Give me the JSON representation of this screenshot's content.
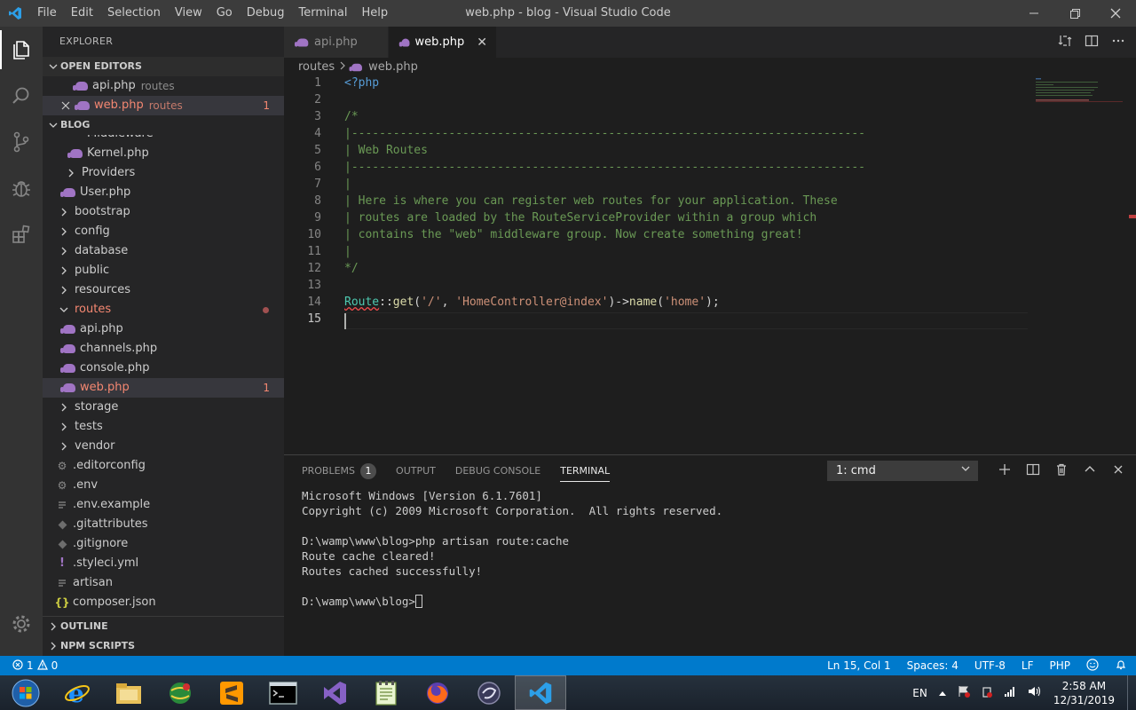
{
  "titlebar": {
    "menu": [
      "File",
      "Edit",
      "Selection",
      "View",
      "Go",
      "Debug",
      "Terminal",
      "Help"
    ],
    "title": "web.php - blog - Visual Studio Code"
  },
  "sidebar": {
    "header": "EXPLORER",
    "open_editors_label": "OPEN EDITORS",
    "open_editors": [
      {
        "name": "api.php",
        "desc": "routes",
        "badge": ""
      },
      {
        "name": "web.php",
        "desc": "routes",
        "badge": "1"
      }
    ],
    "project_label": "BLOG",
    "tree": {
      "partial_top": "Middleware",
      "kernel": "Kernel.php",
      "providers": "Providers",
      "user": "User.php",
      "bootstrap": "bootstrap",
      "config": "config",
      "database": "database",
      "public": "public",
      "resources": "resources",
      "routes": "routes",
      "api": "api.php",
      "channels": "channels.php",
      "console": "console.php",
      "web": "web.php",
      "web_badge": "1",
      "storage": "storage",
      "tests": "tests",
      "vendor": "vendor",
      "editorconfig": ".editorconfig",
      "env": ".env",
      "env_example": ".env.example",
      "gitattributes": ".gitattributes",
      "gitignore": ".gitignore",
      "styleci": ".styleci.yml",
      "artisan": "artisan",
      "composer": "composer.json"
    },
    "outline_label": "OUTLINE",
    "npm_label": "NPM SCRIPTS"
  },
  "tabs": [
    {
      "label": "api.php"
    },
    {
      "label": "web.php"
    }
  ],
  "breadcrumb": {
    "folder": "routes",
    "file": "web.php"
  },
  "code": {
    "line_numbers": [
      "1",
      "2",
      "3",
      "4",
      "5",
      "6",
      "7",
      "8",
      "9",
      "10",
      "11",
      "12",
      "13",
      "14",
      "15"
    ],
    "l1": "<?php",
    "l3": "/*",
    "l4": "|--------------------------------------------------------------------------",
    "l5": "| Web Routes",
    "l6": "|--------------------------------------------------------------------------",
    "l7": "|",
    "l8": "| Here is where you can register web routes for your application. These",
    "l9": "| routes are loaded by the RouteServiceProvider within a group which",
    "l10": "| contains the \"web\" middleware group. Now create something great!",
    "l11": "|",
    "l12": "*/",
    "l14_class": "Route",
    "l14_op1": "::",
    "l14_fn1": "get",
    "l14_p1": "(",
    "l14_s1": "'/'",
    "l14_comma": ", ",
    "l14_s2": "'HomeController@index'",
    "l14_p2": ")->",
    "l14_fn2": "name",
    "l14_p3": "(",
    "l14_s3": "'home'",
    "l14_end": ");"
  },
  "panel": {
    "tabs": [
      "PROBLEMS",
      "OUTPUT",
      "DEBUG CONSOLE",
      "TERMINAL"
    ],
    "problems_count": "1",
    "terminal_select": "1: cmd",
    "terminal_lines": [
      "Microsoft Windows [Version 6.1.7601]",
      "Copyright (c) 2009 Microsoft Corporation.  All rights reserved.",
      "",
      "D:\\wamp\\www\\blog>php artisan route:cache",
      "Route cache cleared!",
      "Routes cached successfully!",
      ""
    ],
    "prompt": "D:\\wamp\\www\\blog>"
  },
  "statusbar": {
    "errors": "1",
    "warnings": "0",
    "position": "Ln 15, Col 1",
    "spaces": "Spaces: 4",
    "encoding": "UTF-8",
    "eol": "LF",
    "language": "PHP"
  },
  "taskbar": {
    "lang": "EN",
    "time": "2:58 AM",
    "date": "12/31/2019"
  },
  "colors": {
    "accent": "#007acc",
    "error": "#f48771",
    "php_icon": "#a074c4"
  }
}
